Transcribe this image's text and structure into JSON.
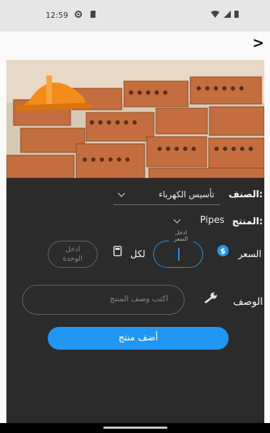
{
  "status_bar": {
    "time": "12:59"
  },
  "form": {
    "category_label": "الصنف:",
    "category_value": "تأسيس الكهرباء",
    "product_label": "المنتج:",
    "product_value": "Pipes",
    "price_label": "السعر",
    "price_float_label_line1": "ادخل",
    "price_float_label_line2": "السعر",
    "per_label": "لكل",
    "unit_placeholder_line1": "ادخل",
    "unit_placeholder_line2": "الوحدة",
    "description_label": "الوصف",
    "description_placeholder": "اكتب وصف المنتج",
    "submit_label": "أضف منتج"
  },
  "colors": {
    "accent": "#2196f3",
    "panel": "#2b2b2b"
  }
}
